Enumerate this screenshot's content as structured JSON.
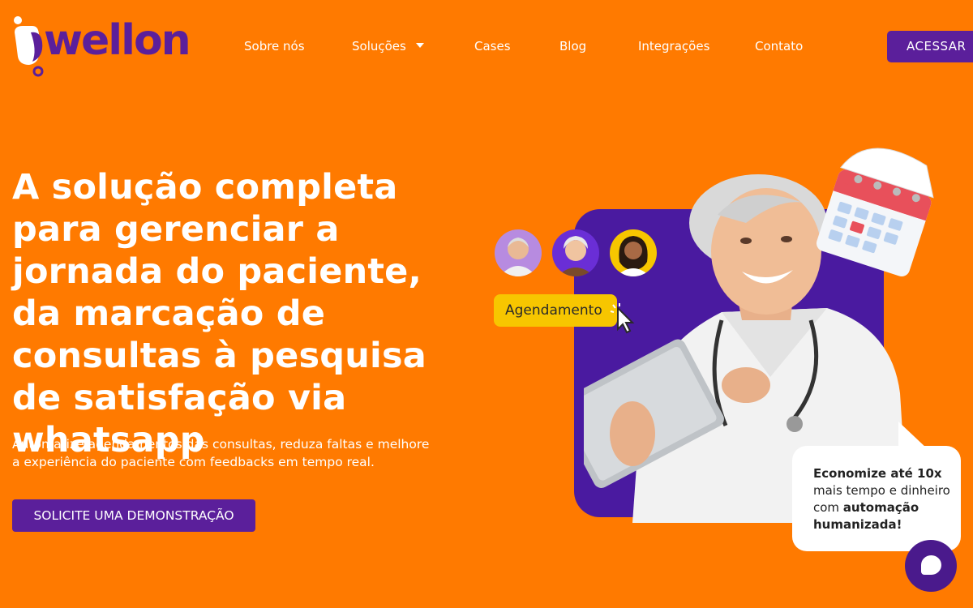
{
  "brand": {
    "name": "wellon",
    "colors": {
      "primary": "#5b1f9b",
      "background": "#ff7a00",
      "tag": "#f7c600"
    }
  },
  "nav": {
    "items": [
      {
        "label": "Sobre nós"
      },
      {
        "label": "Soluções",
        "has_dropdown": true
      },
      {
        "label": "Cases"
      },
      {
        "label": "Blog"
      },
      {
        "label": "Integrações"
      },
      {
        "label": "Contato"
      }
    ],
    "cta_label": "ACESSAR"
  },
  "hero": {
    "title": "A solução completa para gerenciar a jornada do paciente, da marcação de consultas à pesquisa de satisfação via whatsapp",
    "subtitle": "Automatize agendamentos das consultas, reduza faltas e melhore a experiência do paciente com feedbacks em tempo real.",
    "cta_label": "SOLICITE UMA DEMONSTRAÇÃO"
  },
  "illustration": {
    "tag_label": "Agendamento",
    "bubble": {
      "line1": "Economize até 10x",
      "line2": "mais tempo e dinheiro",
      "line3_prefix": "com ",
      "line3_bold": "automação",
      "line4": "humanizada!"
    }
  },
  "chat": {
    "icon": "chat-bubble-icon"
  }
}
